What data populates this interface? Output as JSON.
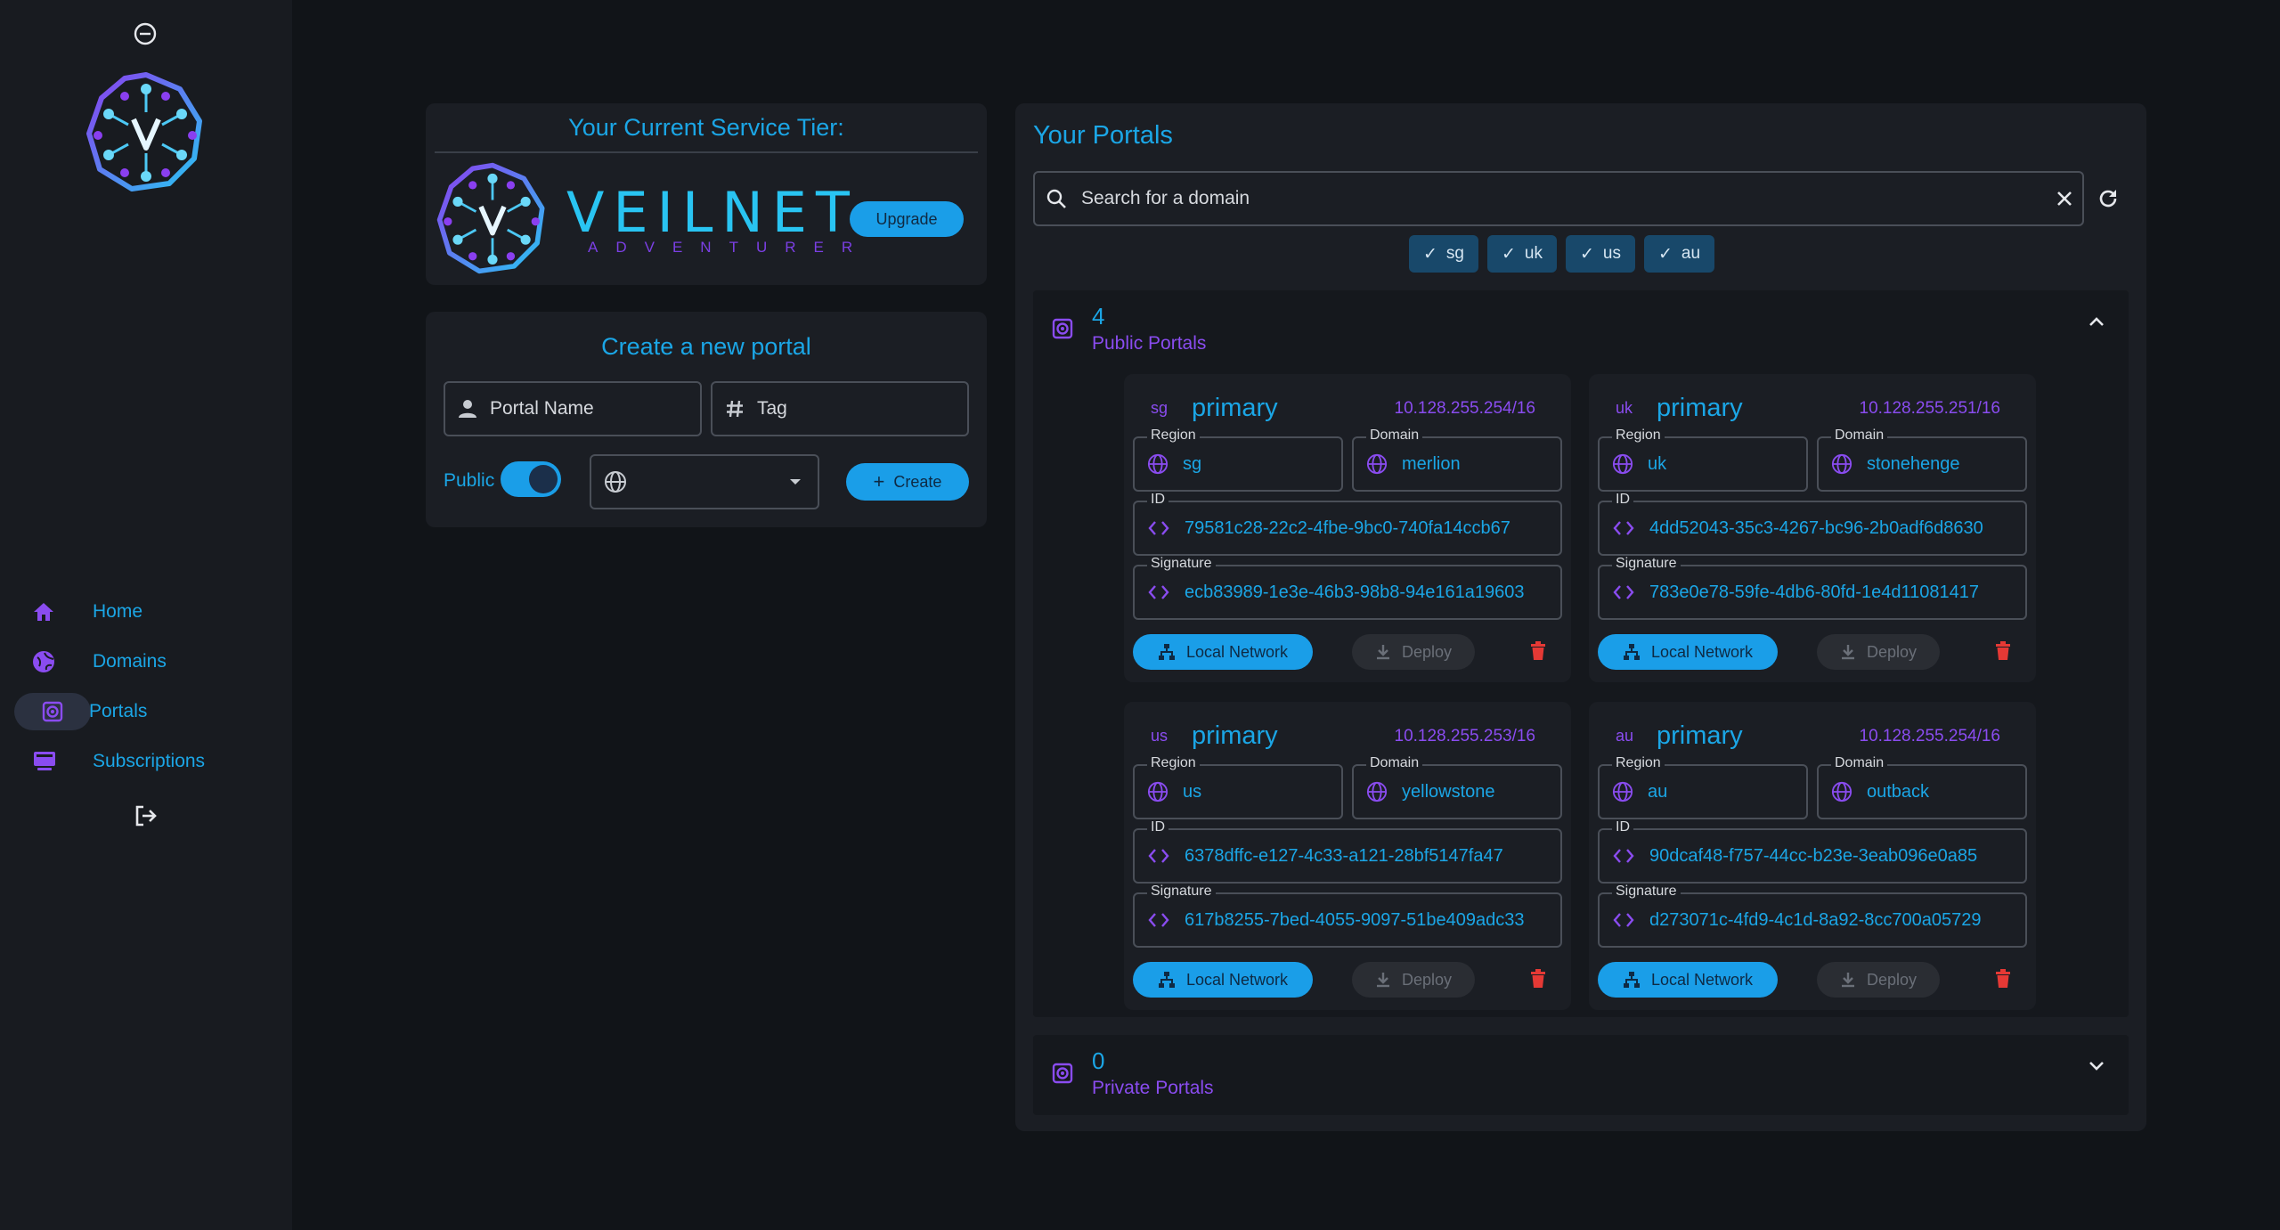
{
  "colors": {
    "accent": "#1a9ee8",
    "purple": "#8a4cf0",
    "danger": "#e53935",
    "bg": "#111418"
  },
  "sidebar": {
    "items": [
      {
        "label": "Home",
        "icon": "home-icon"
      },
      {
        "label": "Domains",
        "icon": "globe-icon"
      },
      {
        "label": "Portals",
        "icon": "portal-icon"
      },
      {
        "label": "Subscriptions",
        "icon": "subscriptions-icon"
      }
    ]
  },
  "tier": {
    "title": "Your Current Service Tier:",
    "brand": "VEILNET",
    "plan": "ADVENTURER",
    "upgrade_label": "Upgrade"
  },
  "create": {
    "title": "Create a new portal",
    "name_placeholder": "Portal Name",
    "tag_placeholder": "Tag",
    "public_label": "Public",
    "create_label": "Create"
  },
  "portals": {
    "title": "Your Portals",
    "search_placeholder": "Search for a domain",
    "filters": [
      "sg",
      "uk",
      "us",
      "au"
    ],
    "public": {
      "count": "4",
      "label": "Public Portals"
    },
    "private": {
      "count": "0",
      "label": "Private Portals"
    },
    "field_labels": {
      "region": "Region",
      "domain": "Domain",
      "id": "ID",
      "signature": "Signature"
    },
    "local_label": "Local Network",
    "deploy_label": "Deploy",
    "cards": [
      {
        "region_code": "sg",
        "name": "primary",
        "ip": "10.128.255.254/16",
        "region": "sg",
        "domain": "merlion",
        "id": "79581c28-22c2-4fbe-9bc0-740fa14ccb67",
        "signature": "ecb83989-1e3e-46b3-98b8-94e161a19603"
      },
      {
        "region_code": "uk",
        "name": "primary",
        "ip": "10.128.255.251/16",
        "region": "uk",
        "domain": "stonehenge",
        "id": "4dd52043-35c3-4267-bc96-2b0adf6d8630",
        "signature": "783e0e78-59fe-4db6-80fd-1e4d11081417"
      },
      {
        "region_code": "us",
        "name": "primary",
        "ip": "10.128.255.253/16",
        "region": "us",
        "domain": "yellowstone",
        "id": "6378dffc-e127-4c33-a121-28bf5147fa47",
        "signature": "617b8255-7bed-4055-9097-51be409adc33"
      },
      {
        "region_code": "au",
        "name": "primary",
        "ip": "10.128.255.254/16",
        "region": "au",
        "domain": "outback",
        "id": "90dcaf48-f757-44cc-b23e-3eab096e0a85",
        "signature": "d273071c-4fd9-4c1d-8a92-8cc700a05729"
      }
    ]
  }
}
